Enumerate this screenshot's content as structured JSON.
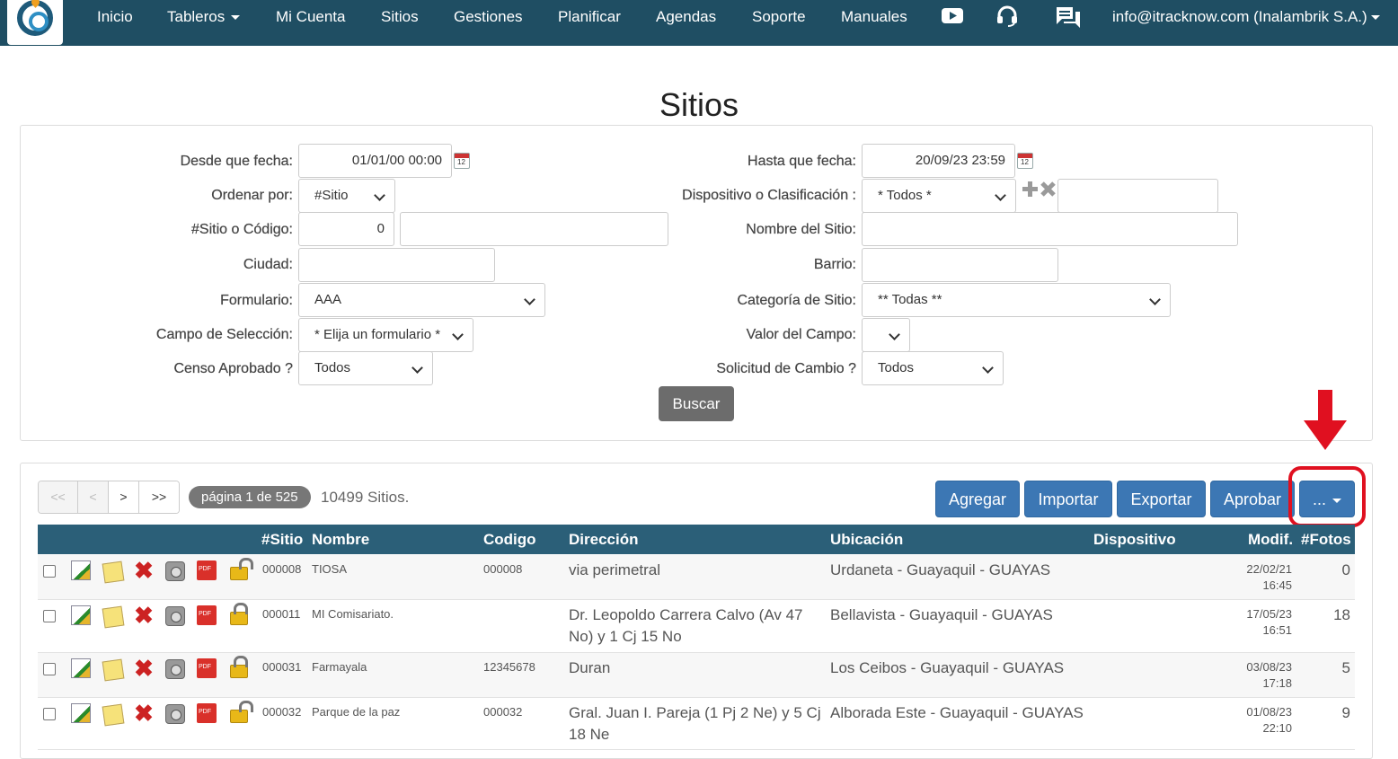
{
  "nav": {
    "items": [
      "Inicio",
      "Tableros",
      "Mi Cuenta",
      "Sitios",
      "Gestiones",
      "Planificar",
      "Agendas",
      "Soporte",
      "Manuales"
    ],
    "user": "info@itracknow.com (Inalambrik S.A.)",
    "icons": [
      "youtube-icon",
      "headset-icon",
      "chat-icon"
    ]
  },
  "title": "Sitios",
  "filters": {
    "desde_label": "Desde que fecha:",
    "desde_value": "01/01/00 00:00",
    "hasta_label": "Hasta que fecha:",
    "hasta_value": "20/09/23 23:59",
    "ordenar_label": "Ordenar por:",
    "ordenar_value": "#Sitio",
    "dispositivo_label": "Dispositivo o Clasificación :",
    "dispositivo_value": "* Todos *",
    "sitio_label": "#Sitio o Código:",
    "sitio_value": "0",
    "nombre_label": "Nombre del Sitio:",
    "ciudad_label": "Ciudad:",
    "barrio_label": "Barrio:",
    "formulario_label": "Formulario:",
    "formulario_value": "AAA",
    "categoria_label": "Categoría de Sitio:",
    "categoria_value": "** Todas **",
    "campo_label": "Campo de Selección:",
    "campo_value": "* Elija un formulario *",
    "valor_label": "Valor del Campo:",
    "censo_label": "Censo Aprobado ?",
    "censo_value": "Todos",
    "solicitud_label": "Solicitud de Cambio ?",
    "solicitud_value": "Todos",
    "buscar": "Buscar"
  },
  "pager": {
    "first": "<<",
    "prev": "<",
    "next": ">",
    "last": ">>",
    "page": "página 1 de 525",
    "count": "10499 Sitios."
  },
  "actions": [
    "Agregar",
    "Importar",
    "Exportar",
    "Aprobar",
    "..."
  ],
  "table": {
    "headers": [
      "#Sitio",
      "Nombre",
      "Codigo",
      "Dirección",
      "Ubicación",
      "Dispositivo",
      "Modif.",
      "#Fotos"
    ],
    "rows": [
      {
        "id": "000008",
        "nombre": "TIOSA",
        "codigo": "000008",
        "dir1": "via perimetral",
        "dir2": "",
        "ubicacion": "Urdaneta - Guayaquil - GUAYAS",
        "fecha": "22/02/21",
        "hora": "16:45",
        "fotos": "0",
        "lock": "open"
      },
      {
        "id": "000011",
        "nombre": "MI Comisariato.",
        "codigo": "",
        "dir1": "Dr. Leopoldo Carrera Calvo (Av 47",
        "dir2": "No) y 1 Cj 15 No",
        "ubicacion": "Bellavista - Guayaquil - GUAYAS",
        "fecha": "17/05/23",
        "hora": "16:51",
        "fotos": "18",
        "lock": "closed"
      },
      {
        "id": "000031",
        "nombre": "Farmayala",
        "codigo": "12345678",
        "dir1": "Duran",
        "dir2": "",
        "ubicacion": "Los Ceibos - Guayaquil - GUAYAS",
        "fecha": "03/08/23",
        "hora": "17:18",
        "fotos": "5",
        "lock": "closed"
      },
      {
        "id": "000032",
        "nombre": "Parque de la paz",
        "codigo": "000032",
        "dir1": "Gral. Juan I. Pareja (1 Pj 2 Ne) y 5 Cj",
        "dir2": "18 Ne",
        "ubicacion": "Alborada Este - Guayaquil - GUAYAS",
        "fecha": "01/08/23",
        "hora": "22:10",
        "fotos": "9",
        "lock": "open"
      }
    ]
  },
  "colors": {
    "navbar": "#1f4e63",
    "table_header": "#2b5f78",
    "action_button": "#3c77b4",
    "highlight": "#e01020"
  }
}
